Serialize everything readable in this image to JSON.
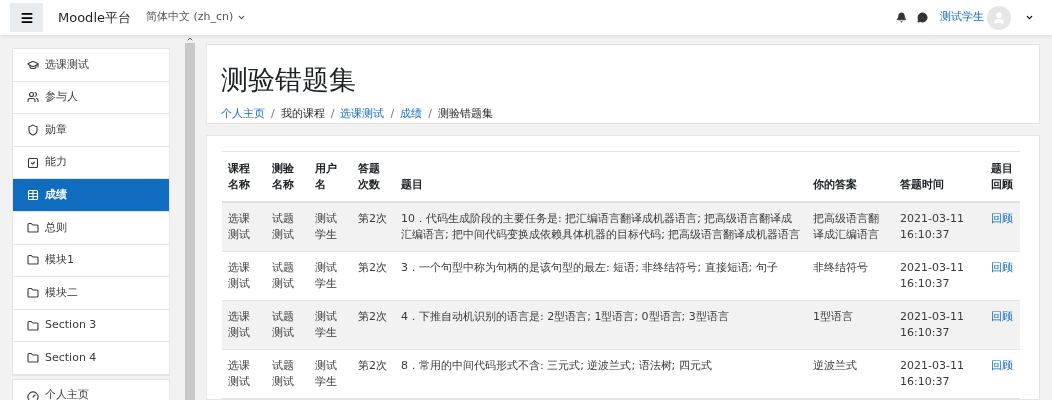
{
  "navbar": {
    "site_name": "Moodle平台",
    "language": "简体中文 (zh_cn)",
    "user_name": "测试学生"
  },
  "sidebar": {
    "items": [
      {
        "label": "选课测试",
        "kind": "course",
        "selected": false
      },
      {
        "label": "参与人",
        "kind": "page",
        "selected": false
      },
      {
        "label": "勋章",
        "kind": "page",
        "selected": false
      },
      {
        "label": "能力",
        "kind": "page",
        "selected": false
      },
      {
        "label": "成绩",
        "kind": "page",
        "selected": true
      },
      {
        "label": "总则",
        "kind": "section",
        "selected": false
      },
      {
        "label": "模块1",
        "kind": "section",
        "selected": false
      },
      {
        "label": "模块二",
        "kind": "section",
        "selected": false
      },
      {
        "label": "Section 3",
        "kind": "section",
        "selected": false
      },
      {
        "label": "Section 4",
        "kind": "section",
        "selected": false
      }
    ],
    "second_items": [
      {
        "label": "个人主页",
        "kind": "page",
        "selected": false
      }
    ]
  },
  "page": {
    "title": "测验错题集",
    "separator": "/",
    "breadcrumb": [
      {
        "label": "个人主页",
        "link": true
      },
      {
        "label": "我的课程",
        "link": false
      },
      {
        "label": "选课测试",
        "link": true
      },
      {
        "label": "成绩",
        "link": true
      },
      {
        "label": "测验错题集",
        "link": false
      }
    ]
  },
  "table": {
    "columns": [
      "课程名称",
      "测验名称",
      "用户名",
      "答题次数",
      "题目",
      "你的答案",
      "答题时间",
      "题目回顾"
    ],
    "rows": [
      {
        "course": "选课测试",
        "quiz": "试题测试",
        "user": "测试学生",
        "attempt": "第2次",
        "question": "10．代码生成阶段的主要任务是: 把汇编语言翻译成机器语言; 把高级语言翻译成汇编语言; 把中间代码变换成依赖具体机器的目标代码; 把高级语言翻译成机器语言",
        "answer": "把高级语言翻译成汇编语言",
        "time": "2021-03-11 16:10:37",
        "review": "回顾"
      },
      {
        "course": "选课测试",
        "quiz": "试题测试",
        "user": "测试学生",
        "attempt": "第2次",
        "question": "3．一个句型中称为句柄的是该句型的最左: 短语; 非终结符号; 直接短语; 句子",
        "answer": "非终结符号",
        "time": "2021-03-11 16:10:37",
        "review": "回顾"
      },
      {
        "course": "选课测试",
        "quiz": "试题测试",
        "user": "测试学生",
        "attempt": "第2次",
        "question": "4．下推自动机识别的语言是: 2型语言; 1型语言; 0型语言; 3型语言",
        "answer": "1型语言",
        "time": "2021-03-11 16:10:37",
        "review": "回顾"
      },
      {
        "course": "选课测试",
        "quiz": "试题测试",
        "user": "测试学生",
        "attempt": "第2次",
        "question": "8．常用的中间代码形式不含: 三元式; 逆波兰式; 语法树; 四元式",
        "answer": "逆波兰式",
        "time": "2021-03-11 16:10:37",
        "review": "回顾"
      }
    ]
  }
}
